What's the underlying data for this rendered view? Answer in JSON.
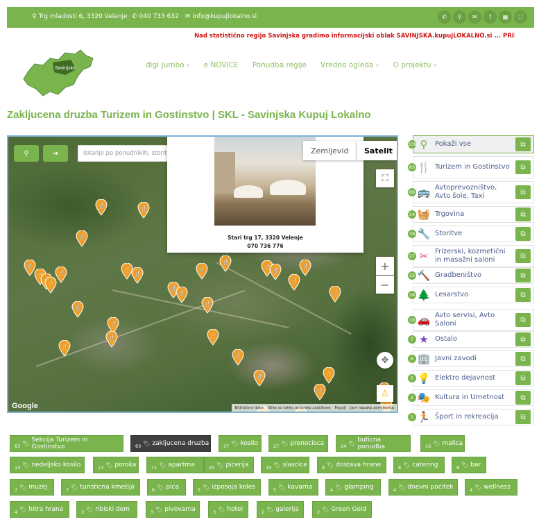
{
  "topbar": {
    "address": "Trg mladosti 6, 3320 Velenje",
    "phone": "040 733 632",
    "email": "info@kupujlokalno.si",
    "social_icons": [
      "phone-icon",
      "map-marker-icon",
      "envelope-icon",
      "facebook-icon",
      "qr-code-icon",
      "sitemap-icon"
    ]
  },
  "header": {
    "ticker": "Nad statistično regijo Savinjska gradimo informacijski oblak SAVINJSKA.kupujLOKALNO.si ... PRID",
    "logo_text": "Savinjska",
    "nav": [
      {
        "label": "digi Jumbo",
        "caret": true
      },
      {
        "label": "e NOVICE",
        "caret": false
      },
      {
        "label": "Ponudba regije",
        "caret": false
      },
      {
        "label": "Vredno ogleda",
        "caret": true
      },
      {
        "label": "O projektu",
        "caret": true
      }
    ]
  },
  "page_title": "Zakljucena druzba Turizem in Gostinstvo | SKL - Savinjska Kupuj Lokalno",
  "map": {
    "search_placeholder": "Iskanje po ponudnikih, storitva",
    "map_type": {
      "map": "Zemljevid",
      "satellite": "Satelit",
      "active": "Satelit"
    },
    "popup": {
      "address": "Stari trg 17, 3320 Velenje",
      "phone": "070 736 776"
    },
    "zoom_in": "+",
    "zoom_out": "−",
    "google": "Google",
    "attribution": [
      "Bližnjične tipke",
      "Slike so lahko avtorsko zaščitene",
      "Pogoji",
      "Javi napako zemljevida"
    ]
  },
  "sidebar": [
    {
      "count": "339",
      "label": "Pokaži vse",
      "icon": "map-pin-icon",
      "color": "#79b44d",
      "active": true
    },
    {
      "count": "83",
      "label": "Turizem in Gostinstvo",
      "icon": "fork-knife-icon",
      "color": "#f0a02a"
    },
    {
      "count": "66",
      "label": "Avtoprevozništvo, Avto šole, Taxi",
      "icon": "bus-icon",
      "color": "#3b4aa0"
    },
    {
      "count": "54",
      "label": "Trgovina",
      "icon": "basket-icon",
      "color": "#79b44d"
    },
    {
      "count": "39",
      "label": "Storitve",
      "icon": "tools-icon",
      "color": "#3b4aa0"
    },
    {
      "count": "27",
      "label": "Frizerski, kozmetični in masažni saloni",
      "icon": "scissors-icon",
      "color": "#e0418a"
    },
    {
      "count": "23",
      "label": "Gradbeništvo",
      "icon": "hammer-icon",
      "color": "#8a4a1f"
    },
    {
      "count": "16",
      "label": "Lesarstvo",
      "icon": "tree-icon",
      "color": "#f0a02a"
    },
    {
      "count": "10",
      "label": "Avto servisi, Avto Saloni",
      "icon": "car-icon",
      "color": "#3b4aa0"
    },
    {
      "count": "7",
      "label": "Ostalo",
      "icon": "star-icon",
      "color": "#7b3fbf"
    },
    {
      "count": "6",
      "label": "Javni zavodi",
      "icon": "building-icon",
      "color": "#3b4aa0"
    },
    {
      "count": "5",
      "label": "Elektro dejavnost",
      "icon": "bulb-icon",
      "color": "#f0a02a"
    },
    {
      "count": "2",
      "label": "Kultura in Umetnost",
      "icon": "theater-masks-icon",
      "color": "#c0304a"
    },
    {
      "count": "1",
      "label": "Šport in rekreacija",
      "icon": "runner-icon",
      "color": "#d0282e"
    }
  ],
  "tags": [
    {
      "count": "63",
      "label": "Sekcija Turizem in Gostinstvo",
      "dark": false
    },
    {
      "count": "63",
      "label": "zakljucena druzba",
      "dark": true
    },
    {
      "count": "27",
      "label": "kosilo",
      "dark": false
    },
    {
      "count": "27",
      "label": "prenocisca",
      "dark": false
    },
    {
      "count": "24",
      "label": "buticna ponudba",
      "dark": false
    },
    {
      "count": "16",
      "label": "malica",
      "dark": false
    },
    {
      "count": "13",
      "label": "nedeljsko kosilo",
      "dark": false
    },
    {
      "count": "13",
      "label": "poroka",
      "dark": false
    },
    {
      "count": "11",
      "label": "apartma",
      "dark": false
    },
    {
      "count": "10",
      "label": "picerija",
      "dark": false
    },
    {
      "count": "10",
      "label": "slascice",
      "dark": false
    },
    {
      "count": "8",
      "label": "dostava hrane",
      "dark": false
    },
    {
      "count": "8",
      "label": "catering",
      "dark": false
    },
    {
      "count": "8",
      "label": "bar",
      "dark": false
    },
    {
      "count": "7",
      "label": "muzej",
      "dark": false
    },
    {
      "count": "7",
      "label": "turisticna kmetija",
      "dark": false
    },
    {
      "count": "6",
      "label": "pica",
      "dark": false
    },
    {
      "count": "5",
      "label": "izposoja koles",
      "dark": false
    },
    {
      "count": "5",
      "label": "kavarna",
      "dark": false
    },
    {
      "count": "4",
      "label": "glamping",
      "dark": false
    },
    {
      "count": "4",
      "label": "dnevni pocitek",
      "dark": false
    },
    {
      "count": "4",
      "label": "wellness",
      "dark": false
    },
    {
      "count": "4",
      "label": "hitra hrana",
      "dark": false
    },
    {
      "count": "3",
      "label": "ribiski dom",
      "dark": false
    },
    {
      "count": "3",
      "label": "pivovarna",
      "dark": false
    },
    {
      "count": "3",
      "label": "hotel",
      "dark": false
    },
    {
      "count": "2",
      "label": "galerija",
      "dark": false
    },
    {
      "count": "2",
      "label": "Green Gold",
      "dark": false
    }
  ]
}
